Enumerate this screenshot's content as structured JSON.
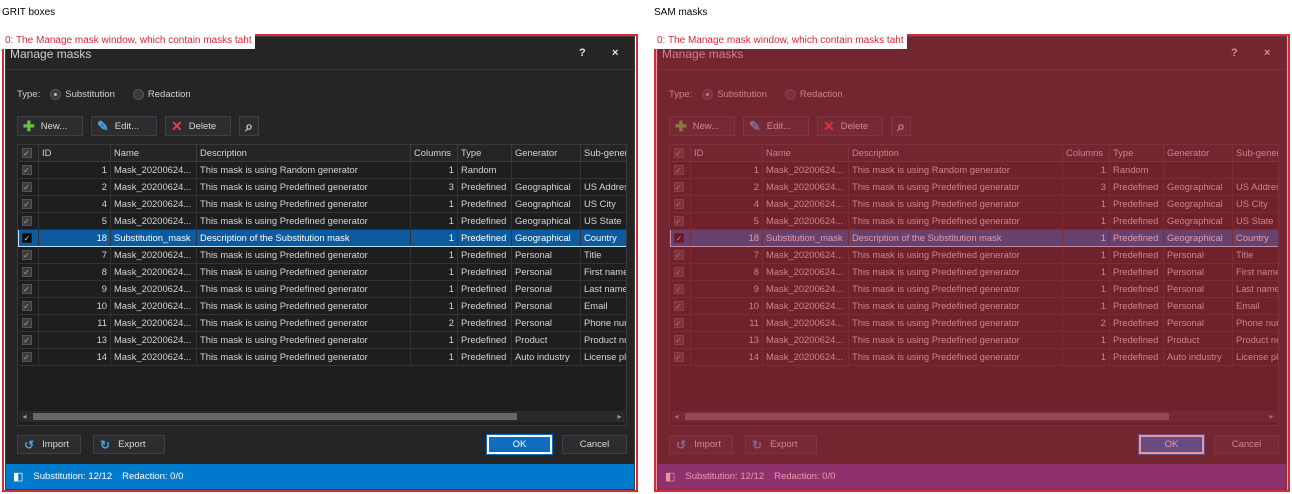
{
  "captions": {
    "left": "GRIT boxes",
    "right": "SAM masks"
  },
  "annotation_label": "0: The Manage mask window, which contain masks taht",
  "window": {
    "title": "Manage masks",
    "help": "?",
    "close": "×"
  },
  "type_row": {
    "label": "Type:",
    "options": [
      "Substitution",
      "Redaction"
    ],
    "selected": "Substitution"
  },
  "toolbar": {
    "new_label": "New...",
    "edit_label": "Edit...",
    "delete_label": "Delete",
    "icons": [
      "plus-icon",
      "pencil-icon",
      "delete-x-icon",
      "search-icon"
    ]
  },
  "table": {
    "columns": [
      "ID",
      "Name",
      "Description",
      "Columns",
      "Type",
      "Generator",
      "Sub-genera"
    ],
    "rows": [
      {
        "id": "1",
        "name": "Mask_20200624...",
        "description": "This mask is using Random generator",
        "columns": "1",
        "type": "Random",
        "generator": "",
        "sub": ""
      },
      {
        "id": "2",
        "name": "Mask_20200624...",
        "description": "This mask is using Predefined generator",
        "columns": "3",
        "type": "Predefined",
        "generator": "Geographical",
        "sub": "US Address"
      },
      {
        "id": "4",
        "name": "Mask_20200624...",
        "description": "This mask is using Predefined generator",
        "columns": "1",
        "type": "Predefined",
        "generator": "Geographical",
        "sub": "US City"
      },
      {
        "id": "5",
        "name": "Mask_20200624...",
        "description": "This mask is using Predefined generator",
        "columns": "1",
        "type": "Predefined",
        "generator": "Geographical",
        "sub": "US State"
      },
      {
        "id": "18",
        "name": "Substitution_mask",
        "description": "Description of the Substitution mask",
        "columns": "1",
        "type": "Predefined",
        "generator": "Geographical",
        "sub": "Country",
        "selected": true
      },
      {
        "id": "7",
        "name": "Mask_20200624...",
        "description": "This mask is using Predefined generator",
        "columns": "1",
        "type": "Predefined",
        "generator": "Personal",
        "sub": "Title"
      },
      {
        "id": "8",
        "name": "Mask_20200624...",
        "description": "This mask is using Predefined generator",
        "columns": "1",
        "type": "Predefined",
        "generator": "Personal",
        "sub": "First name"
      },
      {
        "id": "9",
        "name": "Mask_20200624...",
        "description": "This mask is using Predefined generator",
        "columns": "1",
        "type": "Predefined",
        "generator": "Personal",
        "sub": "Last name"
      },
      {
        "id": "10",
        "name": "Mask_20200624...",
        "description": "This mask is using Predefined generator",
        "columns": "1",
        "type": "Predefined",
        "generator": "Personal",
        "sub": "Email"
      },
      {
        "id": "11",
        "name": "Mask_20200624...",
        "description": "This mask is using Predefined generator",
        "columns": "2",
        "type": "Predefined",
        "generator": "Personal",
        "sub": "Phone num"
      },
      {
        "id": "13",
        "name": "Mask_20200624...",
        "description": "This mask is using Predefined generator",
        "columns": "1",
        "type": "Predefined",
        "generator": "Product",
        "sub": "Product nu"
      },
      {
        "id": "14",
        "name": "Mask_20200624...",
        "description": "This mask is using Predefined generator",
        "columns": "1",
        "type": "Predefined",
        "generator": "Auto industry",
        "sub": "License pla"
      }
    ]
  },
  "buttons": {
    "import_label": "Import",
    "export_label": "Export",
    "ok_label": "OK",
    "cancel_label": "Cancel"
  },
  "status": {
    "substitution": "Substitution: 12/12",
    "redaction": "Redaction: 0/0"
  },
  "colors": {
    "grit_outline": "#d42b3a",
    "sam_mask": "#c8283c",
    "status_bar": "#007acc",
    "selected_row": "#0e5a9e"
  }
}
